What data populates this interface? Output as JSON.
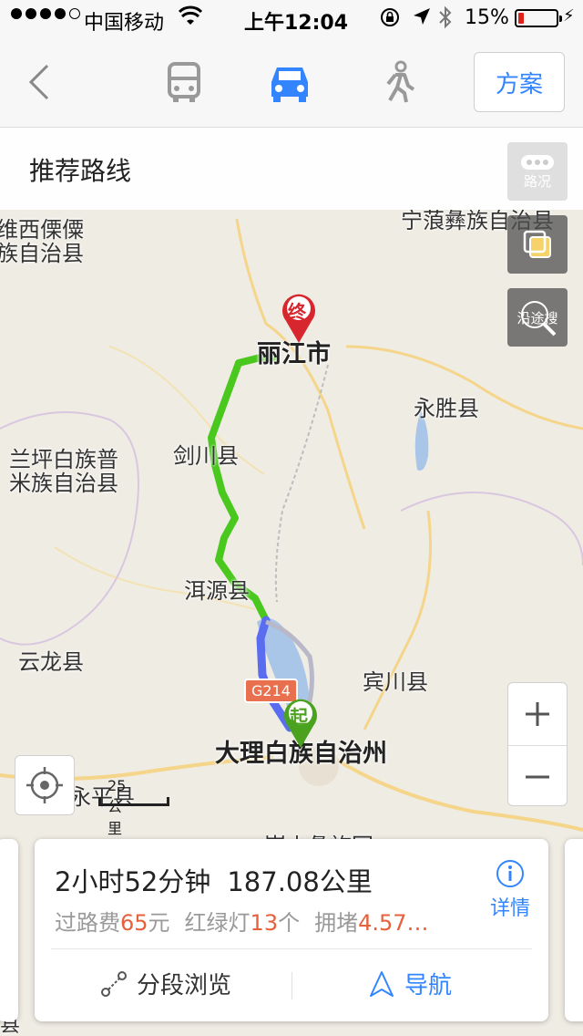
{
  "status_bar": {
    "carrier": "中国移动",
    "time": "上午12:04",
    "battery_text": "15%",
    "battery_level": 0.15
  },
  "nav": {
    "back_icon": "chevron-left-icon",
    "modes": [
      {
        "name": "bus",
        "icon": "bus-icon",
        "active": false
      },
      {
        "name": "car",
        "icon": "car-icon",
        "active": true
      },
      {
        "name": "walk",
        "icon": "walk-icon",
        "active": false
      }
    ],
    "plan_label": "方案",
    "accent_color": "#3385ff"
  },
  "route_bar": {
    "title": "推荐路线"
  },
  "map": {
    "labels": {
      "lijiang": "丽江市",
      "ninglang": "宁蒗彝族自治县",
      "weixi_1": "维西傈僳",
      "weixi_2": "族自治县",
      "lanping_1": "兰坪白族普",
      "lanping_2": "米族自治县",
      "jianchuan": "剑川县",
      "yongsheng": "永胜县",
      "eryuan": "洱源县",
      "yunlong": "云龙县",
      "binchuan": "宾川县",
      "dali": "大理白族自治州",
      "yongping": "永平县",
      "weishan": "巍山彝族回",
      "bottom_county": "县"
    },
    "highway_badge": "G214",
    "start_marker": "起",
    "end_marker": "终",
    "side_buttons": {
      "traffic": "路况",
      "along_search": "沿途搜"
    },
    "scale_label": "25公里",
    "route_colors": {
      "green": "#4ac81e",
      "blue": "#5a6cf0"
    }
  },
  "card": {
    "duration": "2小时52分钟",
    "distance": "187.08公里",
    "toll_label": "过路费",
    "toll_value": "65",
    "toll_unit": "元",
    "lights_label": "红绿灯",
    "lights_value": "13",
    "lights_unit": "个",
    "jam_label": "拥堵",
    "jam_value": "4.57…",
    "details_label": "详情",
    "segment_label": "分段浏览",
    "navigate_label": "导航"
  }
}
